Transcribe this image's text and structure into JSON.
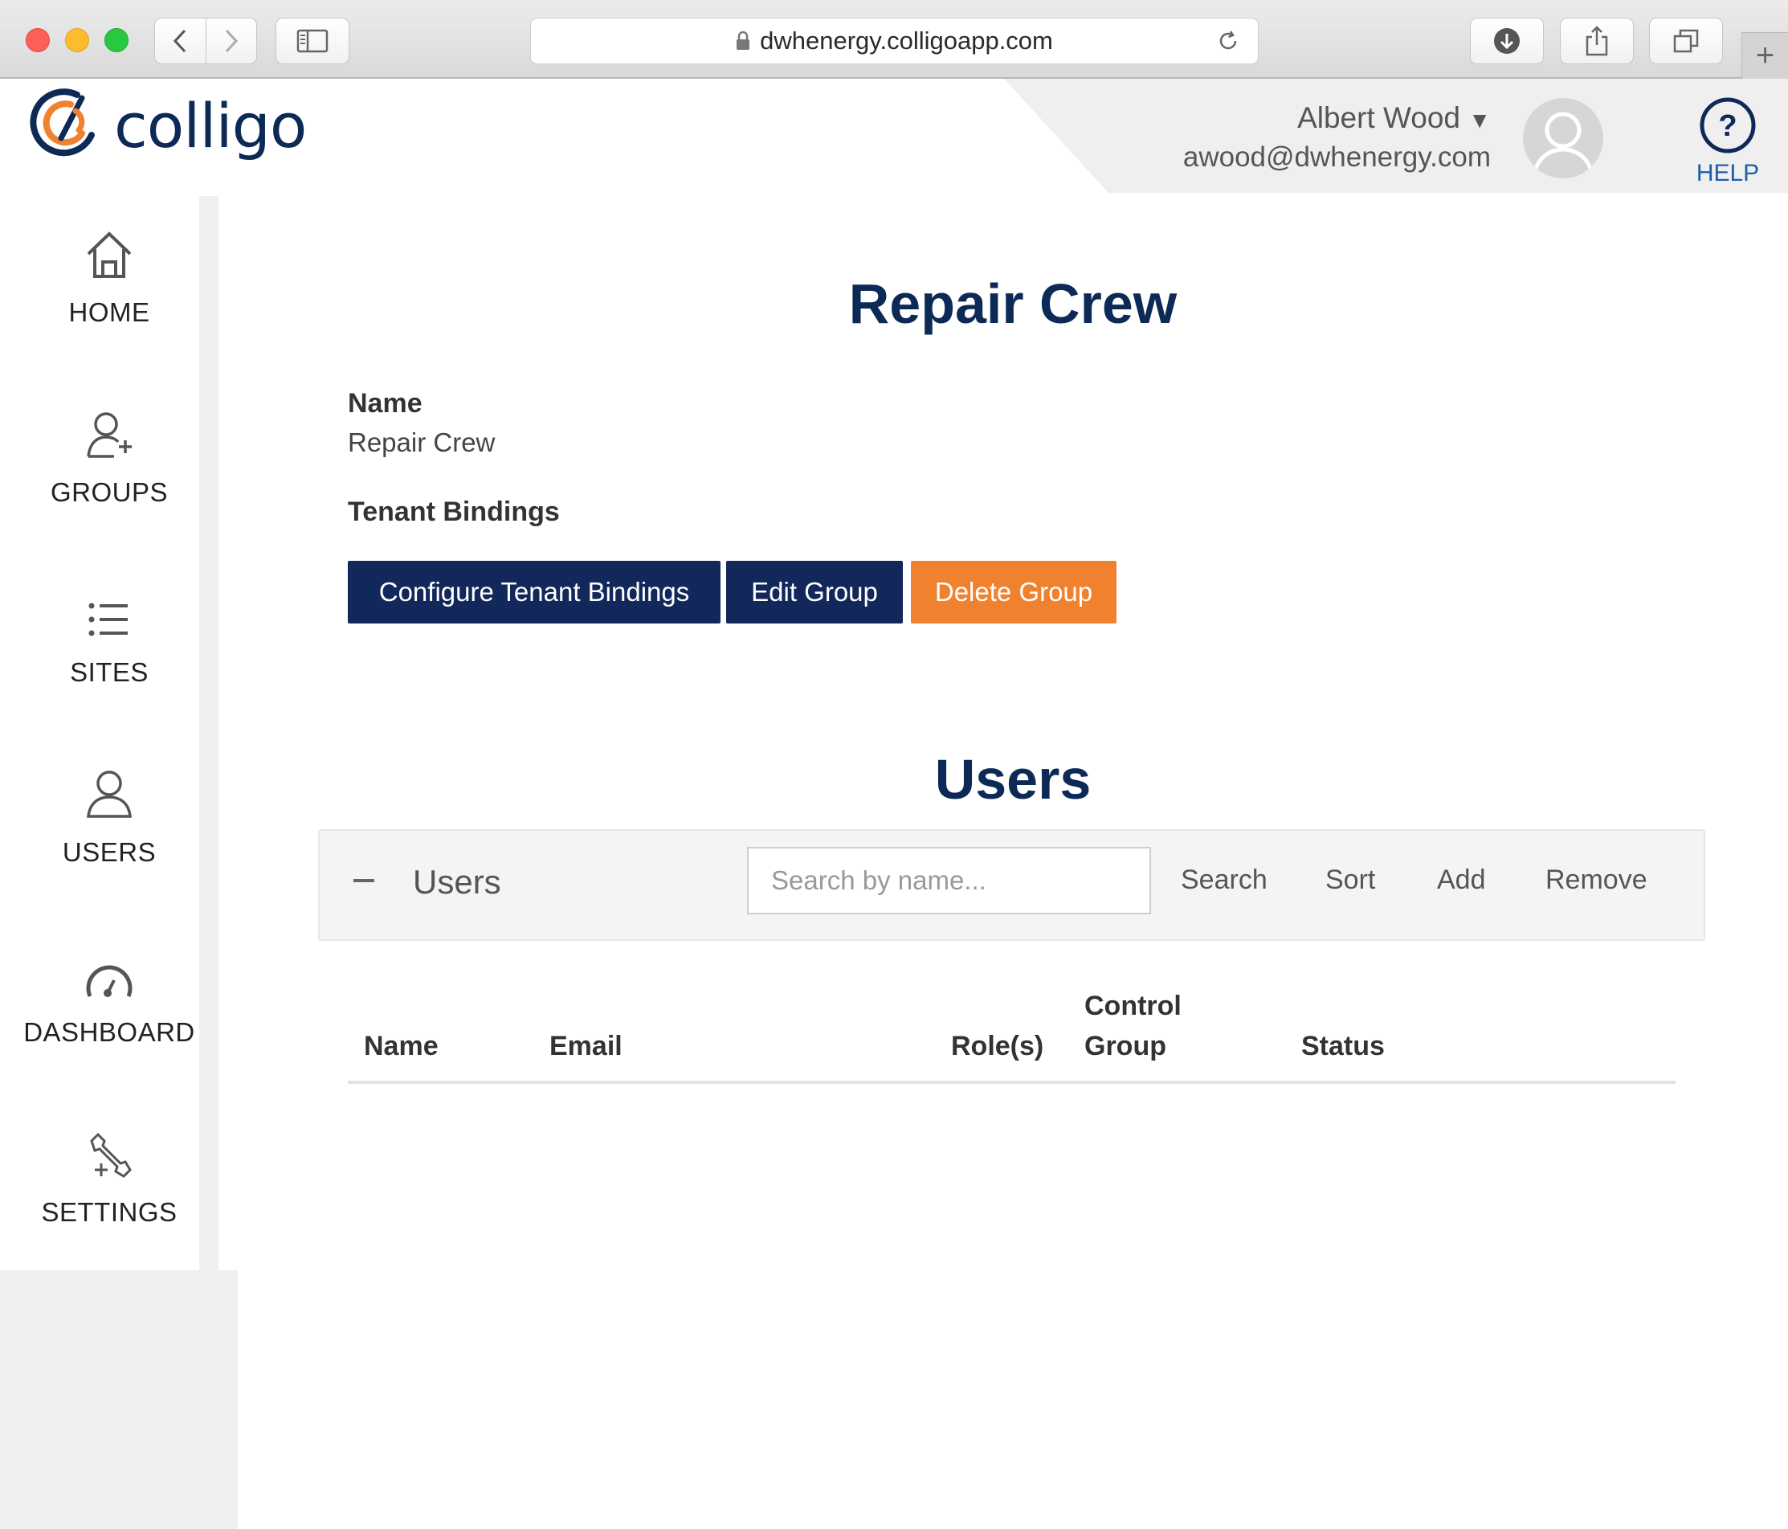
{
  "browser": {
    "url": "dwhenergy.colligoapp.com",
    "new_tab_symbol": "+"
  },
  "header": {
    "logo_text": "colligo",
    "user_name": "Albert Wood",
    "user_caret": "▼",
    "user_email": "awood@dwhenergy.com",
    "help_symbol": "?",
    "help_label": "HELP"
  },
  "nav": {
    "items": [
      {
        "label": "HOME",
        "icon": "home-icon"
      },
      {
        "label": "GROUPS",
        "icon": "add-user-icon"
      },
      {
        "label": "SITES",
        "icon": "list-icon"
      },
      {
        "label": "USERS",
        "icon": "user-icon"
      },
      {
        "label": "DASHBOARD",
        "icon": "gauge-icon"
      },
      {
        "label": "SETTINGS",
        "icon": "tools-icon"
      }
    ]
  },
  "group": {
    "title": "Repair Crew",
    "name_label": "Name",
    "name_value": "Repair Crew",
    "bindings_label": "Tenant Bindings"
  },
  "actions": {
    "configure": "Configure Tenant Bindings",
    "edit": "Edit Group",
    "delete": "Delete Group"
  },
  "users": {
    "section_title": "Users",
    "panel_title": "Users",
    "search_placeholder": "Search by name...",
    "search": "Search",
    "sort": "Sort",
    "add": "Add",
    "remove": "Remove",
    "columns": [
      "Name",
      "Email",
      "Role(s)",
      "Control",
      "Group",
      "Status"
    ],
    "rows": []
  },
  "colors": {
    "navy": "#12275a",
    "orange": "#f0812f",
    "title_blue": "#0d2a57",
    "help_blue": "#1f5fa8"
  }
}
